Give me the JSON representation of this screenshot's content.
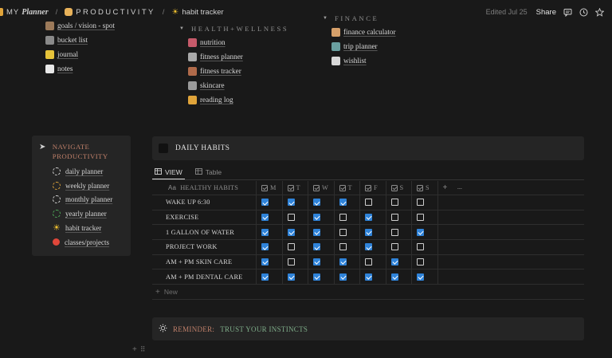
{
  "breadcrumb": {
    "items": [
      {
        "prefix": "MY",
        "label": "Planner"
      },
      {
        "label": "PRODUCTIVITY"
      },
      {
        "label": "habit tracker"
      }
    ],
    "separator": "/"
  },
  "topbar": {
    "edited": "Edited Jul 25",
    "share": "Share"
  },
  "personal": {
    "items": [
      {
        "label": "goals / vision - spot"
      },
      {
        "label": "bucket list"
      },
      {
        "label": "journal"
      },
      {
        "label": "notes"
      }
    ]
  },
  "health": {
    "header": "HEALTH+WELLNESS",
    "items": [
      {
        "label": "nutrition"
      },
      {
        "label": "fitness planner"
      },
      {
        "label": "fitness tracker"
      },
      {
        "label": "skincare"
      },
      {
        "label": "reading log"
      }
    ]
  },
  "finance": {
    "header": "FINANCE",
    "items": [
      {
        "label": "finance calculator"
      },
      {
        "label": "trip planner"
      },
      {
        "label": "wishlist"
      }
    ]
  },
  "navigate": {
    "title_line1": "NAVIGATE",
    "title_line2": "PRODUCTIVITY",
    "items": [
      {
        "label": "daily planner",
        "color": "#d8d8d8"
      },
      {
        "label": "weekly planner",
        "color": "#e0a43a"
      },
      {
        "label": "monthly planner",
        "color": "#d8d8d8"
      },
      {
        "label": "yearly planner",
        "color": "#4fae5a"
      },
      {
        "label": "habit tracker",
        "color": "#f2c230"
      },
      {
        "label": "classes/projects",
        "color": "#e0473a"
      }
    ]
  },
  "habits": {
    "title": "DAILY HABITS",
    "tabs": [
      {
        "label": "VIEW",
        "active": true
      },
      {
        "label": "Table",
        "active": false
      }
    ],
    "name_header_prefix": "Aa",
    "name_header": "HEALTHY HABITS",
    "days": [
      "M",
      "T",
      "W",
      "T",
      "F",
      "S",
      "S"
    ],
    "add_column": "+",
    "more": "···",
    "rows": [
      {
        "name": "WAKE UP 6:30",
        "checks": [
          true,
          true,
          true,
          true,
          false,
          false,
          false
        ]
      },
      {
        "name": "EXERCISE",
        "checks": [
          true,
          false,
          true,
          false,
          true,
          false,
          false
        ]
      },
      {
        "name": "1 GALLON OF WATER",
        "checks": [
          true,
          true,
          true,
          false,
          true,
          false,
          true
        ]
      },
      {
        "name": "PROJECT WORK",
        "checks": [
          true,
          false,
          true,
          false,
          true,
          false,
          false
        ]
      },
      {
        "name": "AM + PM SKIN CARE",
        "checks": [
          true,
          false,
          true,
          true,
          false,
          true,
          false
        ]
      },
      {
        "name": "AM + PM DENTAL CARE",
        "checks": [
          true,
          true,
          true,
          true,
          true,
          true,
          true
        ]
      }
    ],
    "new_row": "New"
  },
  "reminder": {
    "label": "REMINDER:",
    "text": "TRUST YOUR INSTINCTS"
  },
  "accent_colors": {
    "checkbox": "#2f83d9",
    "heading": "#c0806a",
    "reminder_text": "#7fae8a"
  }
}
